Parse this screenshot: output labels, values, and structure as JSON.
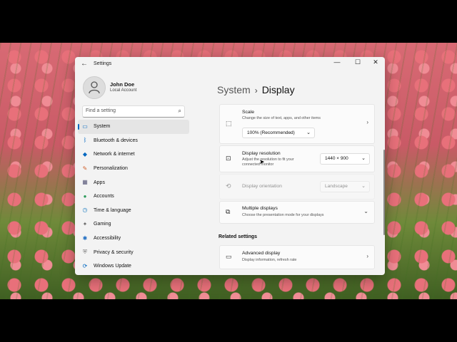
{
  "window": {
    "title": "Settings",
    "back_icon": "arrow-left-icon",
    "controls": [
      "minimize",
      "maximize",
      "close"
    ]
  },
  "profile": {
    "name": "John Doe",
    "account_type": "Local Account"
  },
  "search": {
    "placeholder": "Find a setting"
  },
  "sidebar": {
    "items": [
      {
        "label": "System",
        "icon": "monitor-icon",
        "active": true
      },
      {
        "label": "Bluetooth & devices",
        "icon": "bluetooth-icon"
      },
      {
        "label": "Network & internet",
        "icon": "wifi-icon"
      },
      {
        "label": "Personalization",
        "icon": "brush-icon"
      },
      {
        "label": "Apps",
        "icon": "apps-grid-icon"
      },
      {
        "label": "Accounts",
        "icon": "person-icon"
      },
      {
        "label": "Time & language",
        "icon": "globe-clock-icon"
      },
      {
        "label": "Gaming",
        "icon": "gamepad-icon"
      },
      {
        "label": "Accessibility",
        "icon": "accessibility-icon"
      },
      {
        "label": "Privacy & security",
        "icon": "shield-icon"
      },
      {
        "label": "Windows Update",
        "icon": "refresh-icon"
      }
    ]
  },
  "header": {
    "parent": "System",
    "separator": "›",
    "current": "Display"
  },
  "settings": {
    "scale": {
      "title": "Scale",
      "description": "Change the size of text, apps, and other items",
      "value": "100% (Recommended)"
    },
    "resolution": {
      "title": "Display resolution",
      "description_line1": "Adjust the resolution to fit your",
      "description_line2": "connected monitor",
      "value": "1440 × 900"
    },
    "orientation": {
      "title": "Display orientation",
      "value": "Landscape"
    },
    "multiple_displays": {
      "title": "Multiple displays",
      "description": "Choose the presentation mode for your displays"
    }
  },
  "related": {
    "heading": "Related settings",
    "advanced_display": {
      "title": "Advanced display",
      "description": "Display information, refresh rate"
    }
  },
  "colors": {
    "accent": "#0067c0",
    "window_bg": "#f3f3f3",
    "card_bg": "#fbfbfb"
  }
}
